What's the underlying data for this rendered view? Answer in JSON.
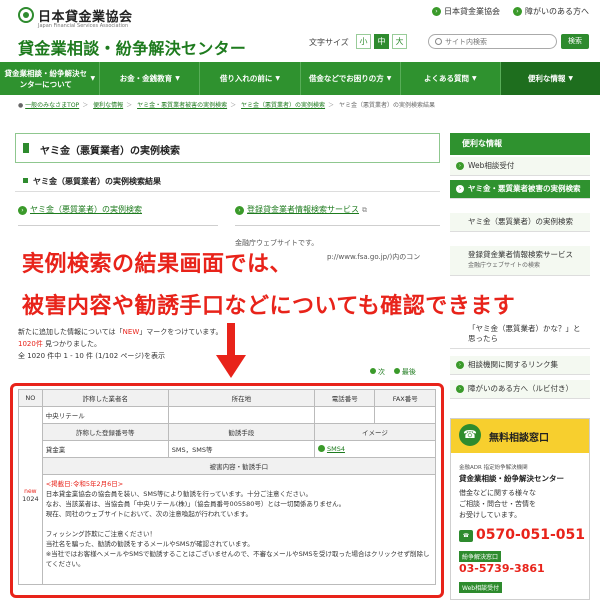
{
  "header": {
    "org_name": "日本貸金業協会",
    "org_sub": "Japan Financial Services Association",
    "center_name": "貸金業相談・紛争解決センター",
    "top_links": [
      "日本貸金業協会",
      "障がいのある方へ"
    ],
    "font_size_label": "文字サイズ",
    "font_sizes": [
      "小",
      "中",
      "大"
    ],
    "font_size_selected": "中",
    "search_placeholder": "サイト内検索",
    "search_button": "検索"
  },
  "nav": {
    "items": [
      "貸金業相談・紛争解決センターについて",
      "お金・金銭教育",
      "借り入れの前に",
      "借金などでお困りの方",
      "よくある質問",
      "便利な情報"
    ]
  },
  "breadcrumb": [
    "一般のみなさまTOP",
    "便利な情報",
    "ヤミ金・悪質業者被害の実例検索",
    "ヤミ金（悪質業者）の実例検索",
    "ヤミ金（悪質業者）の実例検索結果"
  ],
  "main": {
    "page_title": "ヤミ金（悪質業者）の実例検索",
    "section_title": "ヤミ金（悪質業者）の実例検索結果",
    "link_left": "ヤミ金（悪質業者）の実例検索",
    "link_right": "登録貸金業者情報検索サービス",
    "partial_1": "金融庁ウェブサイトです。",
    "partial_2": "p://www.fsa.go.jp/)内のコン",
    "info_line1_pre": "新たに追加した情報については「",
    "info_line1_new": "NEW",
    "info_line1_post": "」マークをつけています。",
    "info_line2_count": "1020件",
    "info_line2_post": " 見つかりました。",
    "info_line3": "全 1020 件中 1 - 10 件 (1/102 ページ)を表示",
    "pager_next": "次",
    "pager_last": "最後"
  },
  "overlay": {
    "line1": "実例検索の結果画面では、",
    "line2": "被害内容や勧誘手口などについても確認できます"
  },
  "table": {
    "headers_row1": [
      "NO",
      "詐称した業者名",
      "所在地",
      "電話番号",
      "FAX番号"
    ],
    "headers_row2": [
      "詐称した登録番号等",
      "勧誘手段",
      "イメージ"
    ],
    "headers_row3": "被害内容・勧誘手口",
    "new_badge": "new",
    "no": "1024",
    "company": "中央リテール",
    "reg_number": "貸金業",
    "method": "SMS，SMS等",
    "image_link": "SMS4",
    "detail_date": "<掲載日:令和5年2月6日>",
    "detail_lines": [
      "日本貸金業協会の協会員を装い、SMS等により勧誘を行っています。十分ご注意ください。",
      "なお、当該業者は、当協会員「中央リテール(株)」（協会員番号005580号）とは一切関係ありません。",
      "現在、同社のウェブサイトにおいて、次の注意喚起が行われています。",
      "",
      "フィッシング詐欺にご注意ください！",
      "当社名を騙った、勧誘の勧誘をするメールやSMSが確認されています。",
      "※当社ではお客様へメールやSMSで勧誘することはございませんので、不審なメールやSMSを受け取った場合はクリックせず削除してください。"
    ]
  },
  "sidebar": {
    "head": "便利な情報",
    "items": [
      {
        "label": "Web相談受付",
        "note": ""
      },
      {
        "label": "ヤミ金・悪質業者被害の実例検索",
        "note": ""
      },
      {
        "label": "ヤミ金（悪質業者）の実例検索",
        "note": ""
      },
      {
        "label": "登録貸金業者情報検索サービス",
        "note": "金融庁ウェブサイトの検索"
      },
      {
        "label": "「ヤミ金（悪質業者）かな？」と思ったら",
        "note": ""
      },
      {
        "label": "相談機関に関するリンク集",
        "note": ""
      },
      {
        "label": "障がいのある方へ（ルビ付き）",
        "note": ""
      }
    ],
    "consult": {
      "title": "無料相談窓口",
      "adr_line": "金融ADR 指定紛争解決機関",
      "center": "貸金業相談・紛争解決センター",
      "body1": "借金などに関する様々な",
      "body2": "ご相談・問合せ・苦情を",
      "body3": "お受けしています。",
      "phone_main": "0570-051-051",
      "tag1": "紛争解決窓口",
      "phone_sub": "03-5739-3861",
      "tag2": "Web相談受付"
    }
  }
}
